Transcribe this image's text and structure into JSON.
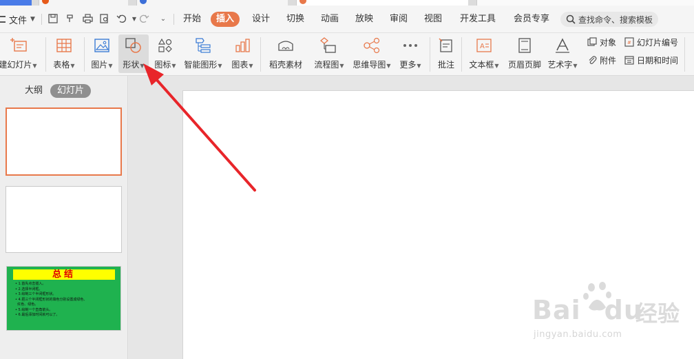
{
  "menubar": {
    "file_label": "文件",
    "tabs": [
      {
        "label": "开始",
        "active": false
      },
      {
        "label": "插入",
        "active": true
      },
      {
        "label": "设计",
        "active": false
      },
      {
        "label": "切换",
        "active": false
      },
      {
        "label": "动画",
        "active": false
      },
      {
        "label": "放映",
        "active": false
      },
      {
        "label": "审阅",
        "active": false
      },
      {
        "label": "视图",
        "active": false
      },
      {
        "label": "开发工具",
        "active": false
      },
      {
        "label": "会员专享",
        "active": false
      }
    ],
    "search_placeholder": "查找命令、搜索模板"
  },
  "ribbon": {
    "new_slide": "建幻灯片",
    "table": "表格",
    "picture": "图片",
    "shape": "形状",
    "icon": "图标",
    "smartart": "智能图形",
    "chart": "图表",
    "daoke": "稻壳素材",
    "flowchart": "流程图",
    "mindmap": "思维导图",
    "more": "更多",
    "comment": "批注",
    "textbox": "文本框",
    "header_footer": "页眉页脚",
    "wordart": "艺术字",
    "object": "对象",
    "attachment": "附件",
    "slide_number": "幻灯片编号",
    "datetime": "日期和时间"
  },
  "leftpanel": {
    "tab_outline": "大纲",
    "tab_slides": "幻灯片"
  },
  "slide3": {
    "title": "总结",
    "items": [
      "1.首先点击插入。",
      "2.选择半闭框。",
      "3.绘制三个半闭框形状。",
      "4.把三个半闭框形状的填色分别设置成绿色、",
      "红色、绿色。",
      "5.绘制一个直角箭头。",
      "6.最后添加时间就可以了。"
    ]
  },
  "colors": {
    "accent": "#e8784a",
    "arrow": "#e8252a",
    "slide3_bg": "#1fb24f",
    "slide3_title_bg": "#ffff00",
    "slide3_title_text": "#e00000"
  },
  "watermark": {
    "brand": "Bai",
    "brand2": "du",
    "cn": "经验",
    "url": "jingyan.baidu.com"
  }
}
